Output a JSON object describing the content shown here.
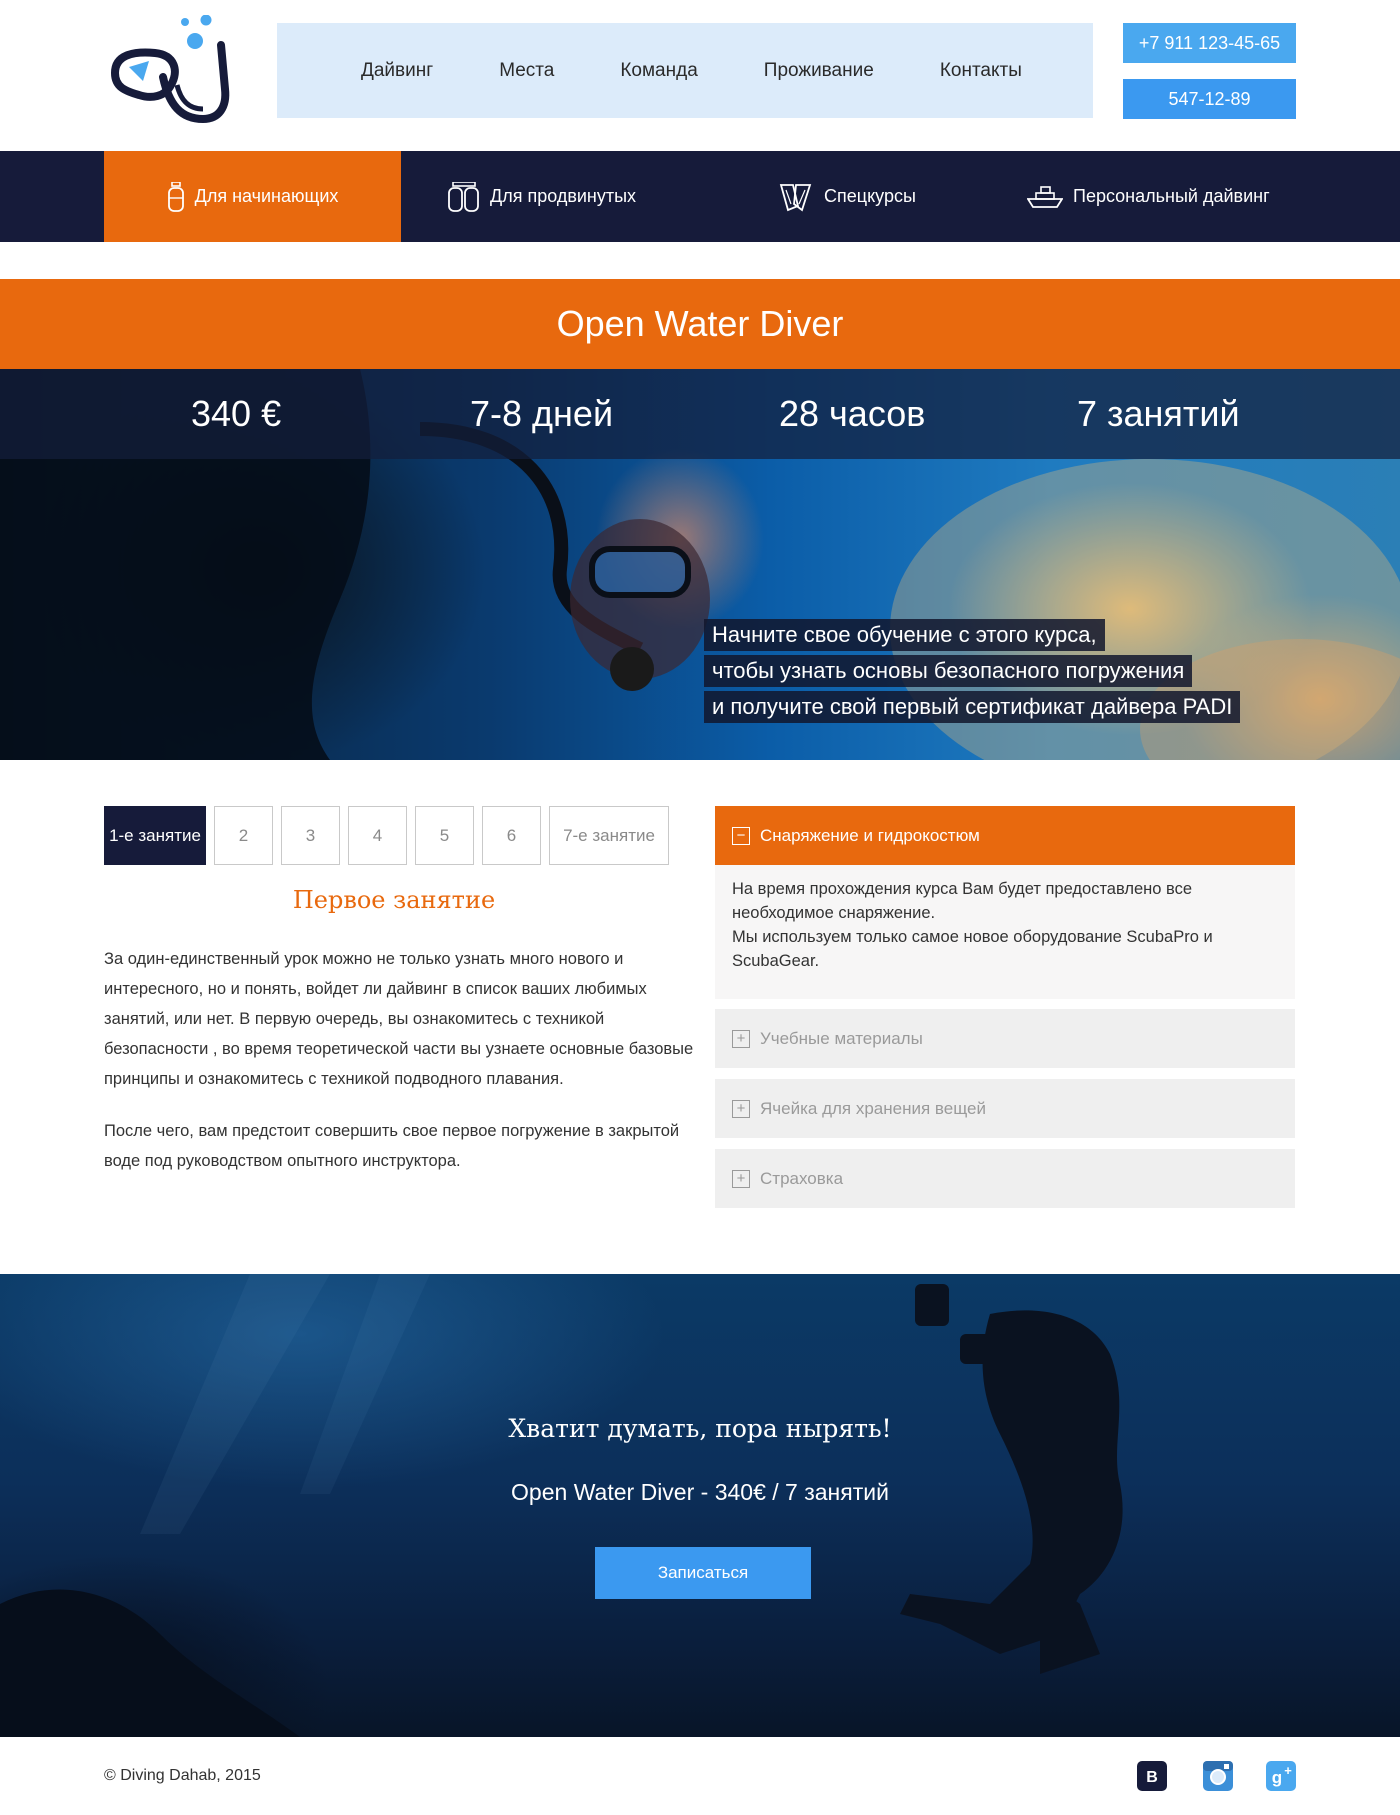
{
  "header": {
    "nav": [
      "Дайвинг",
      "Места",
      "Команда",
      "Проживание",
      "Контакты"
    ],
    "phones": [
      "+7 911 123-45-65",
      "547-12-89"
    ]
  },
  "categories": [
    {
      "label": "Для начинающих",
      "icon": "tank-icon",
      "active": true
    },
    {
      "label": "Для продвинутых",
      "icon": "twin-tank-icon",
      "active": false
    },
    {
      "label": "Спецкурсы",
      "icon": "fins-icon",
      "active": false
    },
    {
      "label": "Персональный дайвинг",
      "icon": "boat-icon",
      "active": false
    }
  ],
  "course": {
    "title": "Open Water Diver",
    "stats": [
      "340 €",
      "7-8 дней",
      "28 часов",
      "7 занятий"
    ],
    "hero_lines": [
      "Начните свое обучение с этого курса,",
      "чтобы узнать основы безопасного погружения",
      "и получите свой первый сертификат дайвера PADI"
    ]
  },
  "lessons": {
    "tabs": [
      "1-е занятие",
      "2",
      "3",
      "4",
      "5",
      "6",
      "7-е занятие"
    ],
    "active_index": 0,
    "title": "Первое занятие",
    "paragraphs": [
      "За один-единственный урок можно не только узнать много нового и интересного, но и понять, войдет ли дайвинг в список ваших любимых занятий, или нет. В первую очередь, вы ознакомитесь с техникой безопасности , во время теоретической части вы узнаете основные базовые принципы и ознакомитесь с техникой подводного плавания.",
      "После чего, вам предстоит совершить свое первое погружение в закрытой воде под руководством опытного инструктора."
    ]
  },
  "accordion": [
    {
      "title": "Снаряжение и гидрокостюм",
      "open": true,
      "body": [
        "На время прохождения курса Вам будет предоставлено все необходимое снаряжение.",
        "Мы используем только самое новое оборудование ScubaPro и ScubaGear."
      ]
    },
    {
      "title": "Учебные материалы",
      "open": false
    },
    {
      "title": "Ячейка для хранения вещей",
      "open": false
    },
    {
      "title": "Страховка",
      "open": false
    }
  ],
  "cta": {
    "heading": "Хватит думать, пора нырять!",
    "subheading": "Open Water Diver - 340€ / 7 занятий",
    "button": "Записаться"
  },
  "footer": {
    "copyright": "© Diving Dahab, 2015",
    "social": [
      "vk-icon",
      "instagram-icon",
      "google-plus-icon"
    ]
  },
  "colors": {
    "accent": "#e8690e",
    "navy": "#161b3a",
    "blue": "#3b99f0",
    "nav_bg": "#dcebfa"
  }
}
